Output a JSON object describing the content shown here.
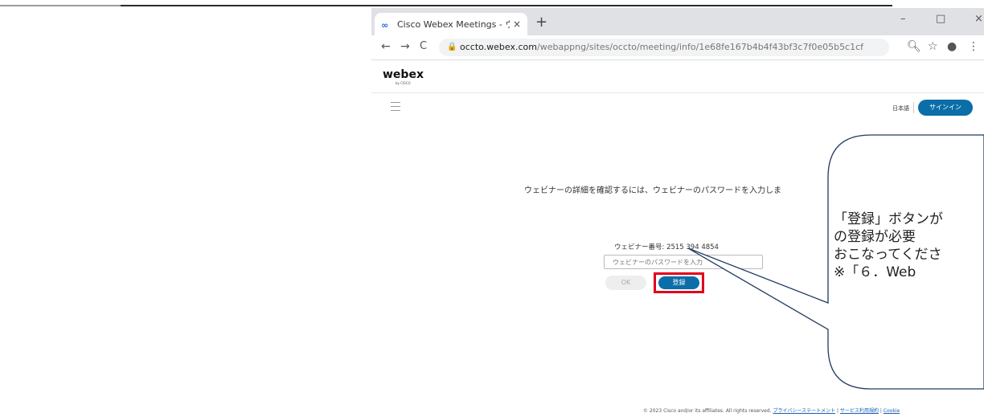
{
  "browser": {
    "tab_title": "Cisco Webex Meetings - ウェビナー",
    "tab_close": "×",
    "new_tab": "+",
    "window_minimize": "–",
    "window_maximize": "□",
    "window_close": "×",
    "nav_back": "←",
    "nav_forward": "→",
    "nav_reload": "C",
    "url_host": "occto.webex.com",
    "url_path": "/webappng/sites/occto/meeting/info/1e68fe167b4b4f43bf3c7f0e05b5c1cf"
  },
  "header": {
    "logo": "webex",
    "logo_sub": "by CISCO",
    "language": "日本語",
    "signin": "サインイン"
  },
  "main": {
    "instruction": "ウェビナーの詳細を確認するには、ウェビナーのパスワードを入力しま",
    "webinar_number": "ウェビナー番号: 2515 394 4854",
    "password_placeholder": "ウェビナーのパスワードを入力",
    "ok_label": "OK",
    "register_label": "登録"
  },
  "footer": {
    "copyright": "© 2023 Cisco and/or its affiliates. All rights reserved.",
    "privacy": "プライバシーステートメント",
    "terms": "サービス利用規約",
    "cookie": "Cookie"
  },
  "callout": {
    "line1": "「登録」ボタンが",
    "line2": "の登録が必要",
    "line3": "おこなってくださ",
    "line4": "※「６．Web"
  },
  "colors": {
    "accent": "#0b6ea8",
    "highlight": "#e0001b"
  }
}
